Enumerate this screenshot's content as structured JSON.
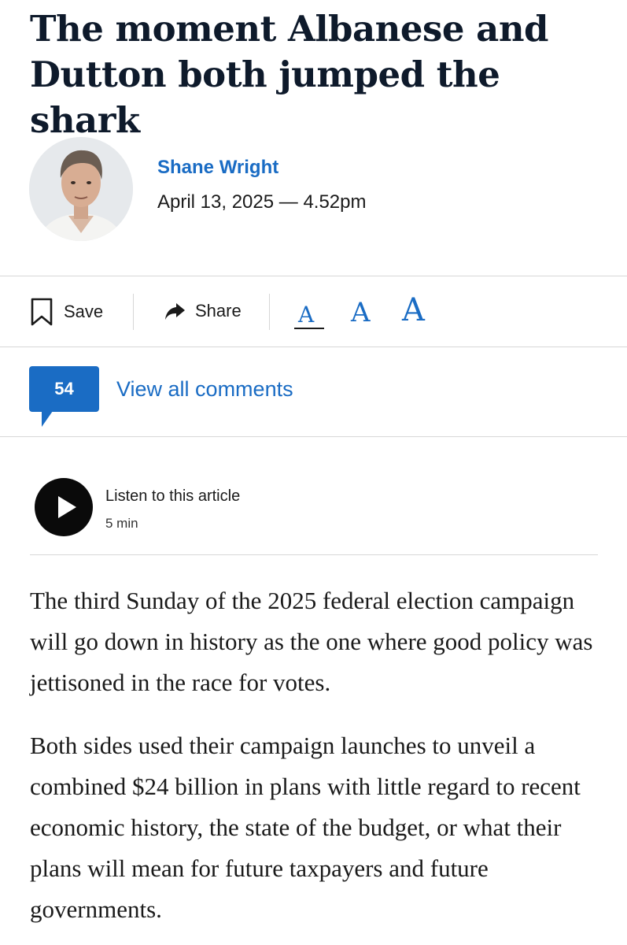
{
  "article": {
    "headline": "The moment Albanese and Dutton both jumped the shark",
    "author": "Shane Wright",
    "published": "April 13, 2025 — 4.52pm"
  },
  "toolbar": {
    "save_label": "Save",
    "share_label": "Share",
    "font_small": "A",
    "font_medium": "A",
    "font_large": "A",
    "selected_font_size": "small"
  },
  "comments": {
    "count": "54",
    "link_label": "View all comments"
  },
  "audio": {
    "title": "Listen to this article",
    "duration": "5 min"
  },
  "body": {
    "paragraphs": [
      "The third Sunday of the 2025 federal election campaign will go down in history as the one where good policy was jettisoned in the race for votes.",
      "Both sides used their campaign launches to unveil a combined $24 billion in plans with little regard to recent economic history, the state of the budget, or what their plans will mean for future taxpayers and future governments."
    ]
  },
  "icons": {
    "save": "bookmark-icon",
    "share": "share-arrow-icon",
    "play": "play-icon",
    "avatar": "author-avatar"
  },
  "colors": {
    "accent": "#1a6cc4",
    "headline": "#0e1a2b",
    "text": "#1a1a1a",
    "divider": "#d7d7d7",
    "play_button": "#0a0a0a"
  }
}
